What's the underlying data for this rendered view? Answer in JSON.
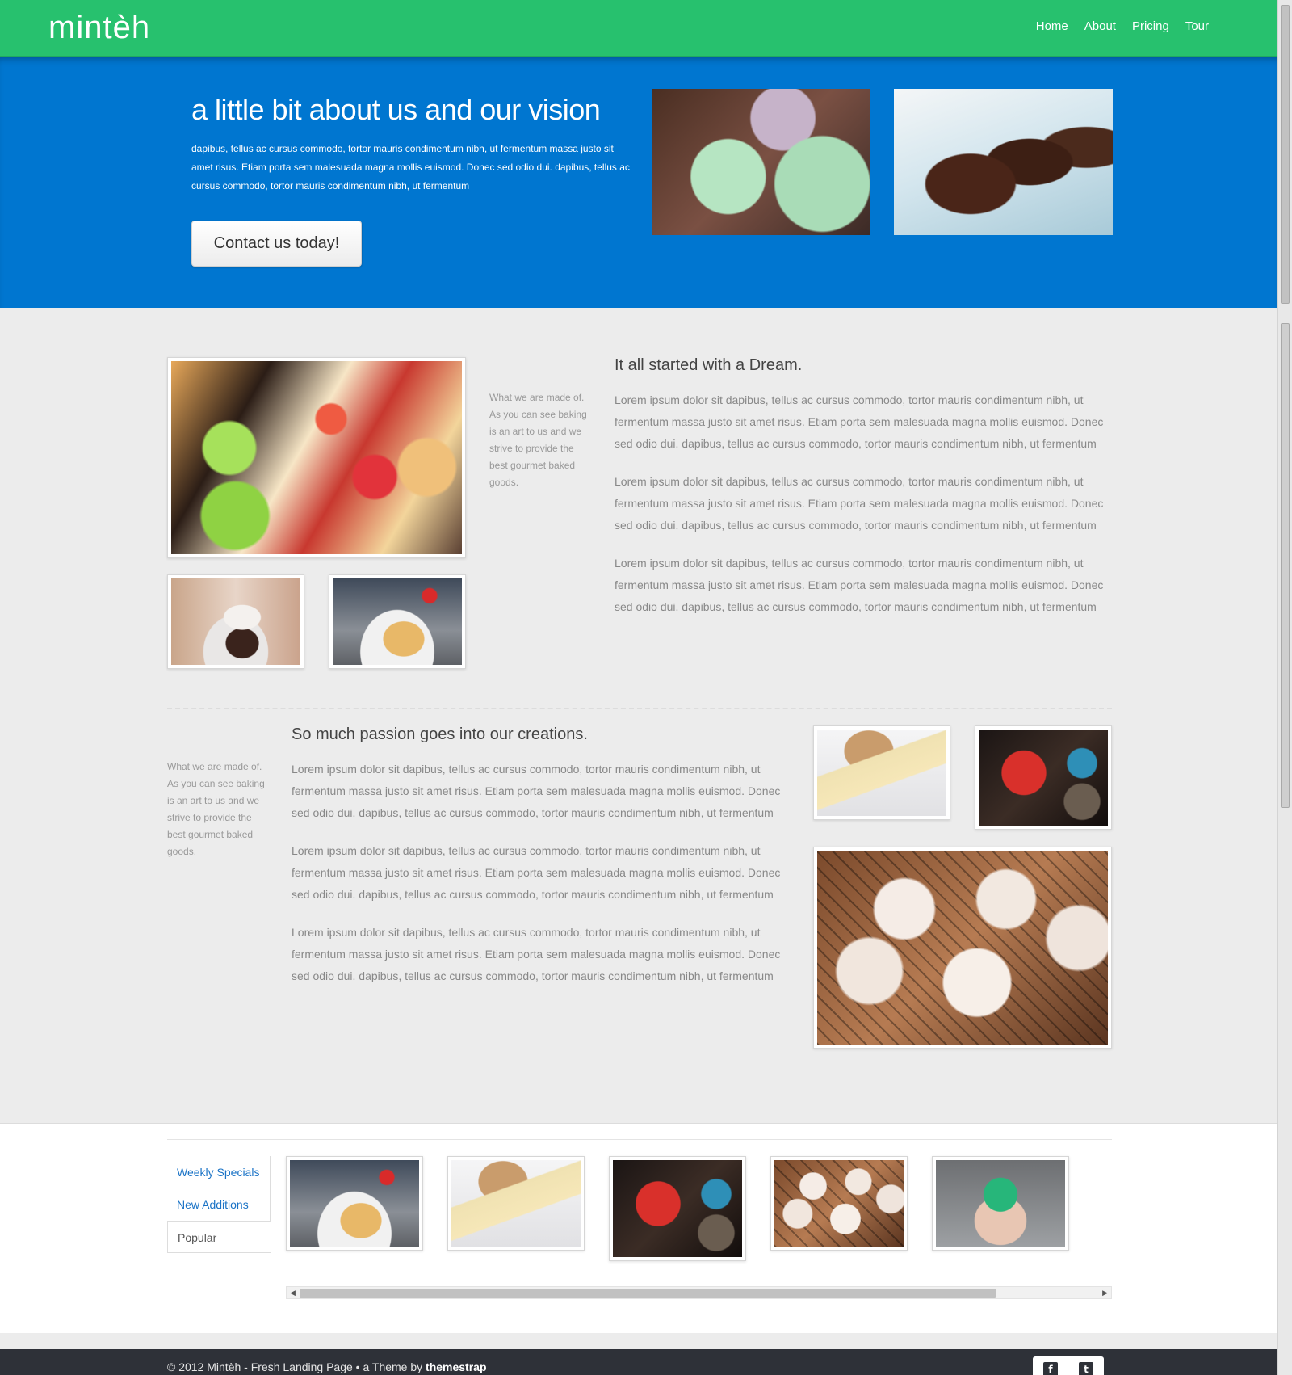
{
  "brand": "mintèh",
  "nav": {
    "home": "Home",
    "about": "About",
    "pricing": "Pricing",
    "tour": "Tour"
  },
  "hero": {
    "title": "a little bit about us and our vision",
    "text": "dapibus, tellus ac cursus commodo, tortor mauris condimentum nibh, ut fermentum massa justo sit amet risus. Etiam porta sem malesuada magna mollis euismod. Donec sed odio dui. dapibus, tellus ac cursus commodo, tortor mauris condimentum nibh, ut fermentum",
    "cta": "Contact us today!"
  },
  "section1": {
    "title": "It all started with a Dream.",
    "side_note": "What we are made of. As you can see baking is an art to us and we strive to provide the best gourmet baked goods.",
    "paragraphs": [
      "Lorem ipsum dolor sit dapibus, tellus ac cursus commodo, tortor mauris condimentum nibh, ut fermentum massa justo sit amet risus. Etiam porta sem malesuada magna mollis euismod. Donec sed odio dui. dapibus, tellus ac cursus commodo, tortor mauris condimentum nibh, ut fermentum",
      "Lorem ipsum dolor sit dapibus, tellus ac cursus commodo, tortor mauris condimentum nibh, ut fermentum massa justo sit amet risus. Etiam porta sem malesuada magna mollis euismod. Donec sed odio dui. dapibus, tellus ac cursus commodo, tortor mauris condimentum nibh, ut fermentum",
      "Lorem ipsum dolor sit dapibus, tellus ac cursus commodo, tortor mauris condimentum nibh, ut fermentum massa justo sit amet risus. Etiam porta sem malesuada magna mollis euismod. Donec sed odio dui. dapibus, tellus ac cursus commodo, tortor mauris condimentum nibh, ut fermentum"
    ]
  },
  "section2": {
    "title": "So much passion goes into our creations.",
    "side_note": "What we are made of. As you can see baking is an art to us and we strive to provide the best gourmet baked goods.",
    "paragraphs": [
      "Lorem ipsum dolor sit dapibus, tellus ac cursus commodo, tortor mauris condimentum nibh, ut fermentum massa justo sit amet risus. Etiam porta sem malesuada magna mollis euismod. Donec sed odio dui. dapibus, tellus ac cursus commodo, tortor mauris condimentum nibh, ut fermentum",
      "Lorem ipsum dolor sit dapibus, tellus ac cursus commodo, tortor mauris condimentum nibh, ut fermentum massa justo sit amet risus. Etiam porta sem malesuada magna mollis euismod. Donec sed odio dui. dapibus, tellus ac cursus commodo, tortor mauris condimentum nibh, ut fermentum",
      "Lorem ipsum dolor sit dapibus, tellus ac cursus commodo, tortor mauris condimentum nibh, ut fermentum massa justo sit amet risus. Etiam porta sem malesuada magna mollis euismod. Donec sed odio dui. dapibus, tellus ac cursus commodo, tortor mauris condimentum nibh, ut fermentum"
    ]
  },
  "gallery": {
    "tabs": [
      "Weekly Specials",
      "New Additions",
      "Popular"
    ],
    "active_tab": "Popular"
  },
  "footer": {
    "copyright": "© 2012 Mintèh - Fresh Landing Page • a Theme by ",
    "author": "themestrap",
    "social": {
      "facebook": "f",
      "twitter": "t"
    }
  },
  "colors": {
    "nav": "#27c16e",
    "hero": "#0076d0",
    "link": "#1a73c6",
    "footer": "#2e3138"
  }
}
